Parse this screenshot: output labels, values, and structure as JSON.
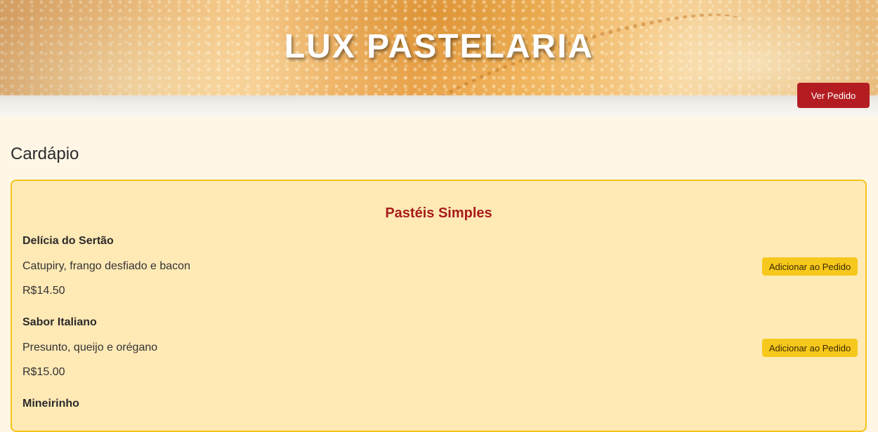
{
  "header": {
    "title": "LUX PASTELARIA",
    "order_button_label": "Ver Pedido"
  },
  "main": {
    "section_title": "Cardápio",
    "category": {
      "title": "Pastéis Simples",
      "items": [
        {
          "name": "Delícia do Sertão",
          "description": "Catupiry, frango desfiado e bacon",
          "price": "R$14.50",
          "button_label": "Adicionar ao Pedido"
        },
        {
          "name": "Sabor Italiano",
          "description": "Presunto, queijo e orégano",
          "price": "R$15.00",
          "button_label": "Adicionar ao Pedido"
        },
        {
          "name": "Mineirinho",
          "description": "",
          "price": "",
          "button_label": ""
        }
      ]
    }
  },
  "colors": {
    "brand_red": "#b31d22",
    "accent_yellow": "#f7c81c",
    "panel_background": "#ffe9b5",
    "page_background": "#fff6e6"
  }
}
